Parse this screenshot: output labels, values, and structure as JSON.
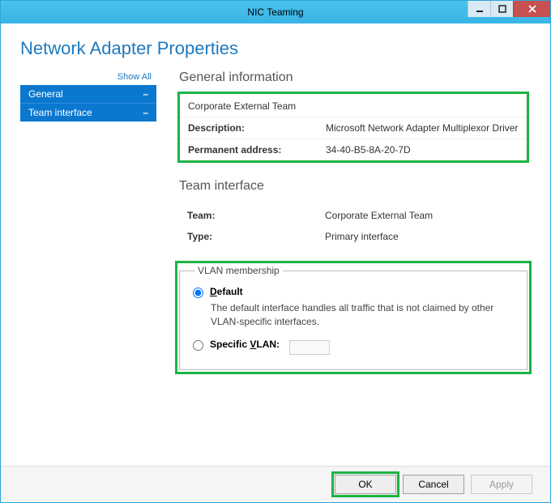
{
  "window": {
    "title": "NIC Teaming"
  },
  "page": {
    "title": "Network Adapter Properties"
  },
  "sidebar": {
    "show_all": "Show All",
    "items": [
      {
        "label": "General"
      },
      {
        "label": "Team interface"
      }
    ]
  },
  "general": {
    "heading": "General information",
    "name": "Corporate External Team",
    "rows": [
      {
        "label": "Description:",
        "value": "Microsoft Network Adapter Multiplexor Driver"
      },
      {
        "label": "Permanent address:",
        "value": "34-40-B5-8A-20-7D"
      }
    ]
  },
  "team_interface": {
    "heading": "Team interface",
    "rows": [
      {
        "label": "Team:",
        "value": "Corporate External Team"
      },
      {
        "label": "Type:",
        "value": "Primary interface"
      }
    ]
  },
  "vlan": {
    "legend": "VLAN membership",
    "default_label": "Default",
    "default_desc": "The default interface handles all traffic that is not claimed by other VLAN-specific interfaces.",
    "specific_label": "Specific VLAN:",
    "specific_value": ""
  },
  "buttons": {
    "ok": "OK",
    "cancel": "Cancel",
    "apply": "Apply"
  }
}
